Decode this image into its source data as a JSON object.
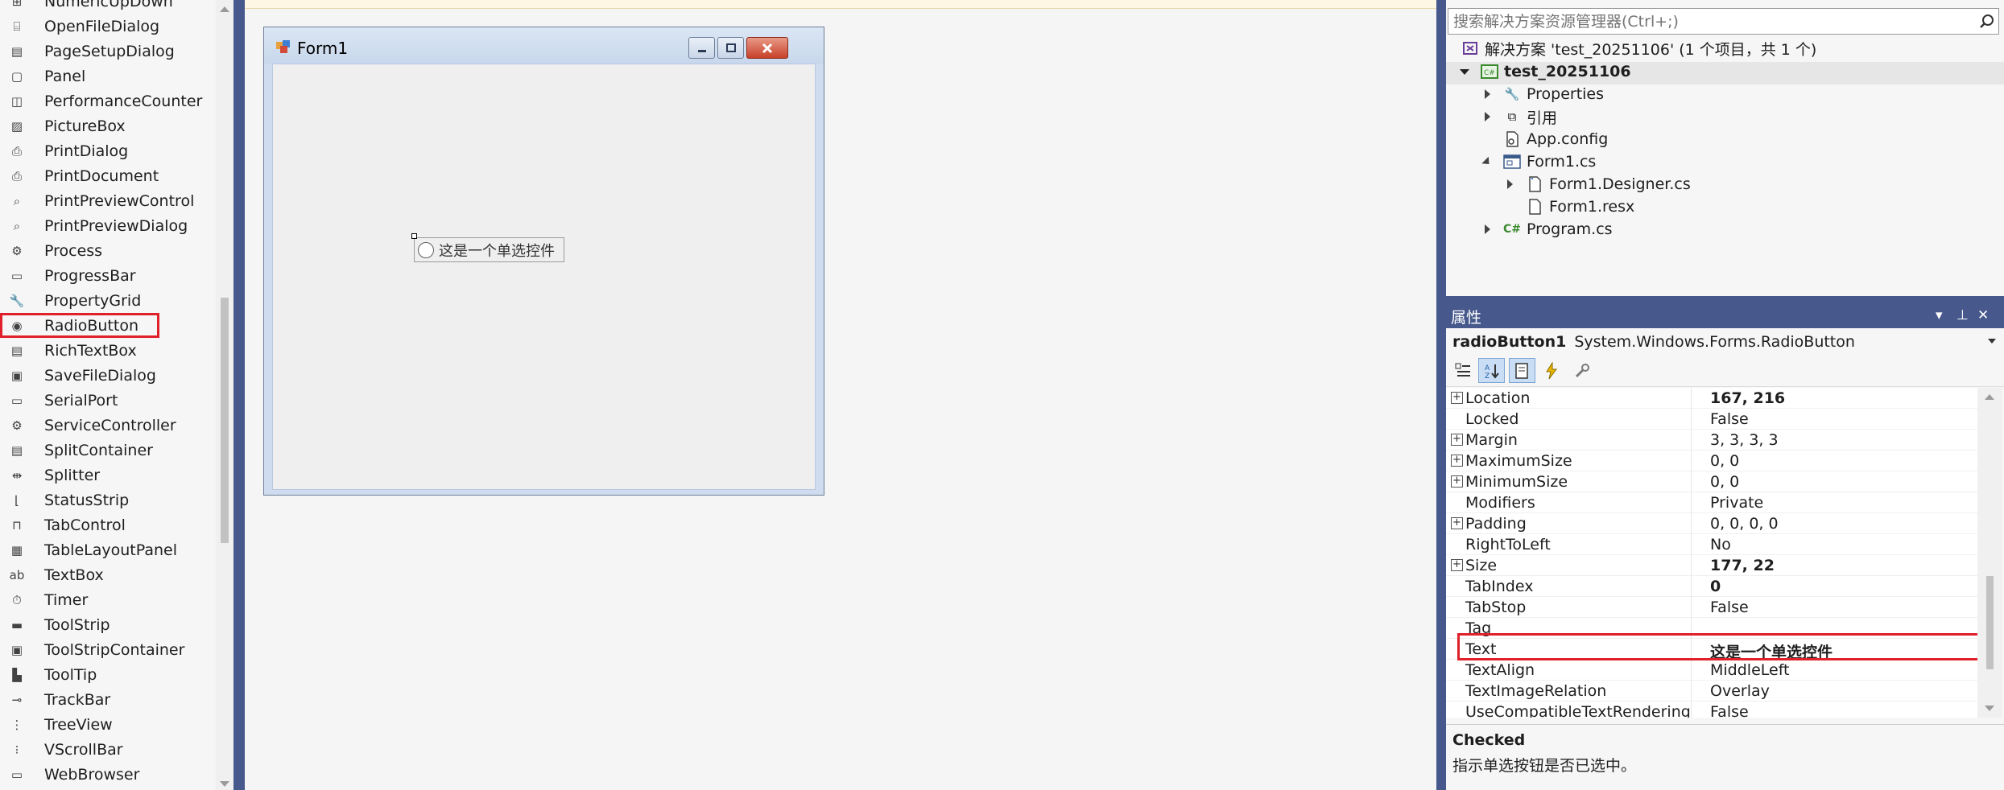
{
  "toolbox": {
    "items": [
      {
        "label": "NumericUpDown",
        "icon": "numeric-updown-icon",
        "glyph": "⊞"
      },
      {
        "label": "OpenFileDialog",
        "icon": "open-file-dialog-icon",
        "glyph": "⌸"
      },
      {
        "label": "PageSetupDialog",
        "icon": "page-setup-dialog-icon",
        "glyph": "▤"
      },
      {
        "label": "Panel",
        "icon": "panel-icon",
        "glyph": "▢"
      },
      {
        "label": "PerformanceCounter",
        "icon": "performance-counter-icon",
        "glyph": "◫"
      },
      {
        "label": "PictureBox",
        "icon": "picturebox-icon",
        "glyph": "▨"
      },
      {
        "label": "PrintDialog",
        "icon": "print-dialog-icon",
        "glyph": "⎙"
      },
      {
        "label": "PrintDocument",
        "icon": "print-document-icon",
        "glyph": "⎙"
      },
      {
        "label": "PrintPreviewControl",
        "icon": "print-preview-control-icon",
        "glyph": "⌕"
      },
      {
        "label": "PrintPreviewDialog",
        "icon": "print-preview-dialog-icon",
        "glyph": "⌕"
      },
      {
        "label": "Process",
        "icon": "process-icon",
        "glyph": "⚙"
      },
      {
        "label": "ProgressBar",
        "icon": "progressbar-icon",
        "glyph": "▭"
      },
      {
        "label": "PropertyGrid",
        "icon": "property-grid-icon",
        "glyph": "🔧"
      },
      {
        "label": "RadioButton",
        "icon": "radiobutton-icon",
        "glyph": "◉"
      },
      {
        "label": "RichTextBox",
        "icon": "richtextbox-icon",
        "glyph": "▤"
      },
      {
        "label": "SaveFileDialog",
        "icon": "save-file-dialog-icon",
        "glyph": "▣"
      },
      {
        "label": "SerialPort",
        "icon": "serialport-icon",
        "glyph": "▭"
      },
      {
        "label": "ServiceController",
        "icon": "service-controller-icon",
        "glyph": "⚙"
      },
      {
        "label": "SplitContainer",
        "icon": "split-container-icon",
        "glyph": "▤"
      },
      {
        "label": "Splitter",
        "icon": "splitter-icon",
        "glyph": "⇹"
      },
      {
        "label": "StatusStrip",
        "icon": "status-strip-icon",
        "glyph": "⌊"
      },
      {
        "label": "TabControl",
        "icon": "tab-control-icon",
        "glyph": "⊓"
      },
      {
        "label": "TableLayoutPanel",
        "icon": "table-layout-panel-icon",
        "glyph": "▦"
      },
      {
        "label": "TextBox",
        "icon": "textbox-icon",
        "glyph": "ab"
      },
      {
        "label": "Timer",
        "icon": "timer-icon",
        "glyph": "⏱"
      },
      {
        "label": "ToolStrip",
        "icon": "toolstrip-icon",
        "glyph": "▬"
      },
      {
        "label": "ToolStripContainer",
        "icon": "toolstrip-container-icon",
        "glyph": "▣"
      },
      {
        "label": "ToolTip",
        "icon": "tooltip-icon",
        "glyph": "▙"
      },
      {
        "label": "TrackBar",
        "icon": "trackbar-icon",
        "glyph": "⊸"
      },
      {
        "label": "TreeView",
        "icon": "treeview-icon",
        "glyph": "⋮"
      },
      {
        "label": "VScrollBar",
        "icon": "vscrollbar-icon",
        "glyph": "⁝"
      },
      {
        "label": "WebBrowser",
        "icon": "webbrowser-icon",
        "glyph": "▭"
      }
    ],
    "highlighted": "RadioButton"
  },
  "designer": {
    "form_title": "Form1",
    "radio_text": "这是一个单选控件"
  },
  "solution_explorer": {
    "search_placeholder": "搜索解决方案资源管理器(Ctrl+;)",
    "solution_label": "解决方案 'test_20251106' (1 个项目，共 1 个)",
    "project": "test_20251106",
    "nodes": {
      "properties": "Properties",
      "references": "引用",
      "app_config": "App.config",
      "form1": "Form1.cs",
      "form1_designer": "Form1.Designer.cs",
      "form1_resx": "Form1.resx",
      "program": "Program.cs"
    }
  },
  "properties": {
    "window_title": "属性",
    "object_name": "radioButton1",
    "object_type": "System.Windows.Forms.RadioButton",
    "rows": [
      {
        "name": "Location",
        "value": "167, 216",
        "expandable": true,
        "bold": true
      },
      {
        "name": "Locked",
        "value": "False",
        "expandable": false,
        "bold": false
      },
      {
        "name": "Margin",
        "value": "3, 3, 3, 3",
        "expandable": true,
        "bold": false
      },
      {
        "name": "MaximumSize",
        "value": "0, 0",
        "expandable": true,
        "bold": false
      },
      {
        "name": "MinimumSize",
        "value": "0, 0",
        "expandable": true,
        "bold": false
      },
      {
        "name": "Modifiers",
        "value": "Private",
        "expandable": false,
        "bold": false
      },
      {
        "name": "Padding",
        "value": "0, 0, 0, 0",
        "expandable": true,
        "bold": false
      },
      {
        "name": "RightToLeft",
        "value": "No",
        "expandable": false,
        "bold": false
      },
      {
        "name": "Size",
        "value": "177, 22",
        "expandable": true,
        "bold": true
      },
      {
        "name": "TabIndex",
        "value": "0",
        "expandable": false,
        "bold": true
      },
      {
        "name": "TabStop",
        "value": "False",
        "expandable": false,
        "bold": false
      },
      {
        "name": "Tag",
        "value": "",
        "expandable": false,
        "bold": false
      },
      {
        "name": "Text",
        "value": "这是一个单选控件",
        "expandable": false,
        "bold": true
      },
      {
        "name": "TextAlign",
        "value": "MiddleLeft",
        "expandable": false,
        "bold": false
      },
      {
        "name": "TextImageRelation",
        "value": "Overlay",
        "expandable": false,
        "bold": false
      },
      {
        "name": "UseCompatibleTextRendering",
        "value": "False",
        "expandable": false,
        "bold": false
      }
    ],
    "highlighted_row": "Text",
    "description_title": "Checked",
    "description_text": "指示单选按钮是否已选中。"
  },
  "colors": {
    "accent_divider": "#47598c",
    "highlight_red": "#e0202a"
  }
}
